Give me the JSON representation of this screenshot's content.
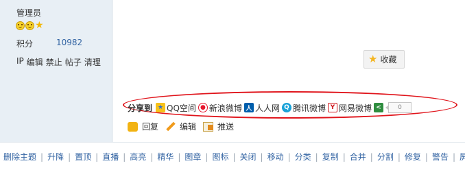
{
  "sidebar": {
    "username": "管理员",
    "points_label": "积分",
    "points_value": "10982",
    "admin_links": [
      "IP",
      "编辑",
      "禁止",
      "帖子",
      "清理"
    ]
  },
  "favorite": {
    "label": "收藏"
  },
  "share": {
    "title": "分享到",
    "items": [
      "QQ空间",
      "新浪微博",
      "人人网",
      "腾讯微博",
      "网易微博"
    ],
    "count": "0"
  },
  "actions": {
    "reply": "回复",
    "edit": "编辑",
    "push": "推送"
  },
  "modbar": [
    "删除主题",
    "升降",
    "置顶",
    "直播",
    "高亮",
    "精华",
    "图章",
    "图标",
    "关闭",
    "移动",
    "分类",
    "复制",
    "合并",
    "分割",
    "修复",
    "警告",
    "屏蔽"
  ],
  "colors": {
    "link": "#3364a3",
    "highlight_ellipse": "#e0141b",
    "sidebar_bg": "#e8eff5"
  }
}
